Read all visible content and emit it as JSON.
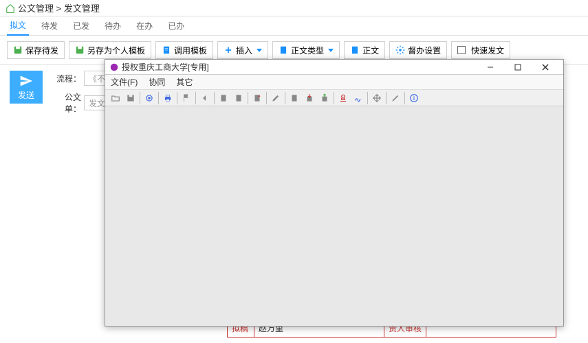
{
  "breadcrumb": {
    "part1": "公文管理",
    "sep": ">",
    "part2": "发文管理"
  },
  "tabs": [
    "拟文",
    "待发",
    "已发",
    "待办",
    "在办",
    "已办"
  ],
  "toolbar": {
    "savePending": "保存待发",
    "saveAsTemplate": "另存为个人模板",
    "callTemplate": "调用模板",
    "insert": "插入",
    "bodyType": "正文类型",
    "body": "正文",
    "supervise": "督办设置",
    "quickSend": "快速发文"
  },
  "send": {
    "label": "发送"
  },
  "form": {
    "processLabel": "流程：",
    "processValue": "《不允许",
    "docLabel": "公文单：",
    "docValue": "发文单…"
  },
  "modal": {
    "title": "授权重庆工商大学[专用]",
    "menu": {
      "file": "文件(F)",
      "coord": "协同",
      "other": "其它"
    }
  },
  "bgTable": {
    "drafted": "拟稿",
    "name1": "赵万里",
    "reviewer": "责人审核"
  }
}
